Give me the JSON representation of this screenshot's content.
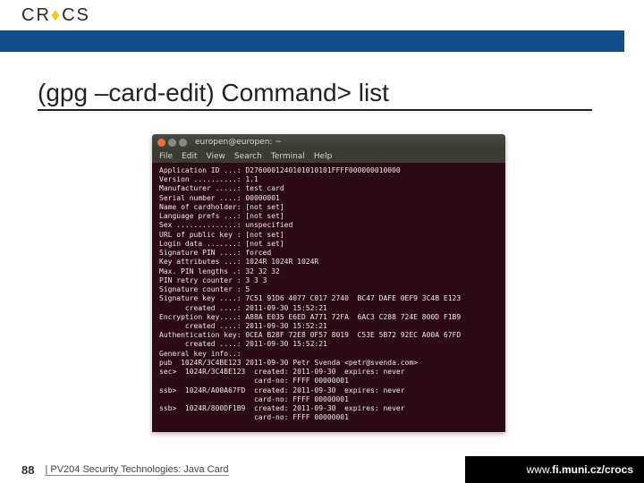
{
  "logo": {
    "text_left": "CR",
    "accent": "CS",
    "gap": " "
  },
  "slide": {
    "title": "(gpg –card-edit) Command> list"
  },
  "terminal": {
    "window_title": "europen@europen: ~",
    "menus": [
      "File",
      "Edit",
      "View",
      "Search",
      "Terminal",
      "Help"
    ],
    "lines": [
      "Application ID ...: D2760001240101010101FFFF000000010000",
      "Version ..........: 1.1",
      "Manufacturer .....: test card",
      "Serial number ....: 00000001",
      "Name of cardholder: [not set]",
      "Language prefs ...: [not set]",
      "Sex ..............: unspecified",
      "URL of public key : [not set]",
      "Login data .......: [not set]",
      "Signature PIN ....: forced",
      "Key attributes ...: 1024R 1024R 1024R",
      "Max. PIN lengths .: 32 32 32",
      "PIN retry counter : 3 3 3",
      "Signature counter : 5",
      "Signature key ....: 7C51 91D6 4077 C017 2740  BC47 DAFE 0EF9 3C4B E123",
      "      created ....: 2011-09-30 15:52:21",
      "Encryption key....: A88A E035 E6ED A771 72FA  6AC3 C288 724E 800D F1B9",
      "      created ....: 2011-09-30 15:52:21",
      "Authentication key: 0CEA B28F 72E8 0F57 8019  C53E 5B72 92EC A00A 67FD",
      "      created ....: 2011-09-30 15:52:21",
      "General key info..:",
      "pub  1024R/3C4BE123 2011-09-30 Petr Svenda <petr@svenda.com>",
      "sec>  1024R/3C4BE123  created: 2011-09-30  expires: never",
      "                      card-no: FFFF 00000001",
      "ssb>  1024R/A00A67FD  created: 2011-09-30  expires: never",
      "                      card-no: FFFF 00000001",
      "ssb>  1024R/800DF1B9  created: 2011-09-30  expires: never",
      "                      card-no: FFFF 00000001"
    ]
  },
  "footer": {
    "page": "88",
    "text": "| PV204 Security Technologies: Java Card",
    "url_prefix": "www.",
    "url_bold": "fi.muni.cz/crocs"
  }
}
